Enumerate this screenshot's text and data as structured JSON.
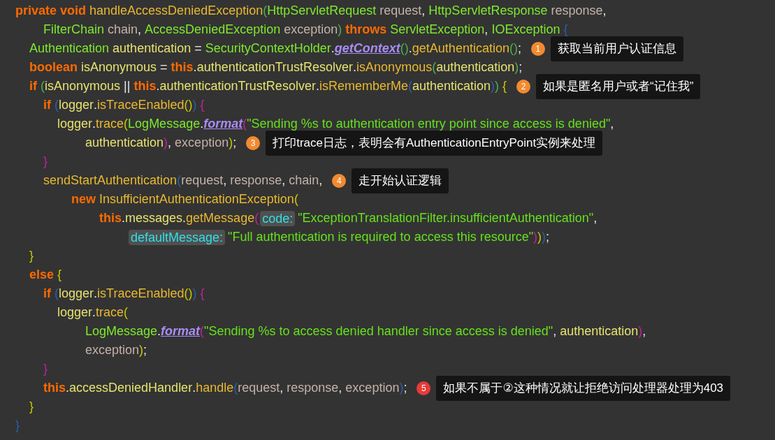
{
  "editor": {
    "lines": [
      {
        "kind": "statement",
        "tokens": [
          {
            "text": "private",
            "kind": "kw"
          },
          {
            "text": " void",
            "kind": "kw"
          },
          {
            "text": " handleAccessDeniedException",
            "kind": "fn"
          },
          {
            "text": "(",
            "kind": "bracket",
            "color": "#4caf50"
          },
          {
            "text": "HttpServletRequest",
            "kind": "type"
          },
          {
            "text": " request",
            "kind": "param"
          },
          {
            "text": ", ",
            "kind": "punct"
          },
          {
            "text": "HttpServletResponse",
            "kind": "type"
          },
          {
            "text": " response",
            "kind": "param"
          },
          {
            "text": ",",
            "kind": "punct"
          }
        ],
        "children": [
          {
            "kind": "continuation",
            "tokens": [
              {
                "text": "FilterChain",
                "kind": "type"
              },
              {
                "text": " chain",
                "kind": "param"
              },
              {
                "text": ", ",
                "kind": "punct"
              },
              {
                "text": "AccessDeniedException",
                "kind": "type"
              },
              {
                "text": " exception",
                "kind": "param"
              },
              {
                "text": ")",
                "kind": "bracket",
                "color": "#4caf50"
              },
              {
                "text": " throws",
                "kind": "kw"
              },
              {
                "text": " ServletException",
                "kind": "type"
              },
              {
                "text": ", ",
                "kind": "punct"
              },
              {
                "text": "IOException",
                "kind": "type"
              },
              {
                "text": " {",
                "kind": "bracket",
                "color": "#2a5fa8"
              }
            ]
          },
          {
            "kind": "statement",
            "tokens": [
              {
                "text": "Authentication",
                "kind": "type"
              },
              {
                "text": " authentication",
                "kind": "var"
              },
              {
                "text": " = ",
                "kind": "punct"
              },
              {
                "text": "SecurityContextHolder",
                "kind": "type"
              },
              {
                "text": ".",
                "kind": "punct"
              },
              {
                "text": "getContext",
                "kind": "static"
              },
              {
                "text": "()",
                "kind": "bracket",
                "color": "#4caf50"
              },
              {
                "text": ".",
                "kind": "punct"
              },
              {
                "text": "getAuthentication",
                "kind": "fn"
              },
              {
                "text": "()",
                "kind": "bracket",
                "color": "#4caf50"
              },
              {
                "text": ";",
                "kind": "punct"
              }
            ],
            "note": {
              "number": "1",
              "color": "#f28a30",
              "text": "获取当前用户认证信息"
            }
          },
          {
            "kind": "statement",
            "tokens": [
              {
                "text": "boolean",
                "kind": "kw"
              },
              {
                "text": " isAnonymous",
                "kind": "var"
              },
              {
                "text": " = ",
                "kind": "punct"
              },
              {
                "text": "this",
                "kind": "kw"
              },
              {
                "text": ".",
                "kind": "punct"
              },
              {
                "text": "authenticationTrustResolver",
                "kind": "var"
              },
              {
                "text": ".",
                "kind": "punct"
              },
              {
                "text": "isAnonymous",
                "kind": "fn"
              },
              {
                "text": "(",
                "kind": "bracket",
                "color": "#4caf50"
              },
              {
                "text": "authentication",
                "kind": "var"
              },
              {
                "text": ")",
                "kind": "bracket",
                "color": "#4caf50"
              },
              {
                "text": ";",
                "kind": "punct"
              }
            ]
          },
          {
            "kind": "statement",
            "tokens": [
              {
                "text": "if",
                "kind": "kw"
              },
              {
                "text": " (",
                "kind": "bracket",
                "color": "#4caf50"
              },
              {
                "text": "isAnonymous",
                "kind": "var"
              },
              {
                "text": " || ",
                "kind": "punct"
              },
              {
                "text": "this",
                "kind": "kw"
              },
              {
                "text": ".",
                "kind": "punct"
              },
              {
                "text": "authenticationTrustResolver",
                "kind": "var"
              },
              {
                "text": ".",
                "kind": "punct"
              },
              {
                "text": "isRememberMe",
                "kind": "fn"
              },
              {
                "text": "(",
                "kind": "bracket",
                "color": "#2a5fa8"
              },
              {
                "text": "authentication",
                "kind": "var"
              },
              {
                "text": ")",
                "kind": "bracket",
                "color": "#2a5fa8"
              },
              {
                "text": ")",
                "kind": "bracket",
                "color": "#4caf50"
              },
              {
                "text": " {",
                "kind": "bracket",
                "color": "#c8c800"
              }
            ],
            "note": {
              "number": "2",
              "color": "#f28a30",
              "text": "如果是匿名用户或者“记住我”"
            },
            "children": [
              {
                "kind": "statement",
                "tokens": [
                  {
                    "text": "if",
                    "kind": "kw"
                  },
                  {
                    "text": " (",
                    "kind": "bracket",
                    "color": "#2a5fa8"
                  },
                  {
                    "text": "logger",
                    "kind": "var"
                  },
                  {
                    "text": ".",
                    "kind": "punct"
                  },
                  {
                    "text": "isTraceEnabled",
                    "kind": "fn"
                  },
                  {
                    "text": "()",
                    "kind": "bracket",
                    "color": "#c8c800"
                  },
                  {
                    "text": ")",
                    "kind": "bracket",
                    "color": "#2a5fa8"
                  },
                  {
                    "text": " {",
                    "kind": "bracket",
                    "color": "#c020a0"
                  }
                ],
                "children": [
                  {
                    "kind": "statement",
                    "tokens": [
                      {
                        "text": "logger",
                        "kind": "var"
                      },
                      {
                        "text": ".",
                        "kind": "punct"
                      },
                      {
                        "text": "trace",
                        "kind": "fn"
                      },
                      {
                        "text": "(",
                        "kind": "bracket",
                        "color": "#c8c800"
                      },
                      {
                        "text": "LogMessage",
                        "kind": "type"
                      },
                      {
                        "text": ".",
                        "kind": "punct"
                      },
                      {
                        "text": "format",
                        "kind": "static"
                      },
                      {
                        "text": "(",
                        "kind": "bracket",
                        "color": "#c020a0"
                      },
                      {
                        "text": "\"Sending %s to authentication entry point since access is denied\"",
                        "kind": "str"
                      },
                      {
                        "text": ",",
                        "kind": "punct"
                      }
                    ],
                    "children": [
                      {
                        "kind": "continuation",
                        "tokens": [
                          {
                            "text": "authentication",
                            "kind": "var"
                          },
                          {
                            "text": ")",
                            "kind": "bracket",
                            "color": "#c020a0"
                          },
                          {
                            "text": ", ",
                            "kind": "punct"
                          },
                          {
                            "text": "exception",
                            "kind": "param"
                          },
                          {
                            "text": ")",
                            "kind": "bracket",
                            "color": "#c8c800"
                          },
                          {
                            "text": ";",
                            "kind": "punct"
                          }
                        ],
                        "note": {
                          "number": "3",
                          "color": "#f28a30",
                          "text": "打印trace日志，表明会有AuthenticationEntryPoint实例来处理"
                        }
                      }
                    ]
                  }
                ]
              },
              {
                "kind": "statement",
                "tokens": [
                  {
                    "text": "}",
                    "kind": "bracket",
                    "color": "#c020a0"
                  }
                ]
              },
              {
                "kind": "statement",
                "tokens": [
                  {
                    "text": "sendStartAuthentication",
                    "kind": "fn"
                  },
                  {
                    "text": "(",
                    "kind": "bracket",
                    "color": "#2a5fa8"
                  },
                  {
                    "text": "request",
                    "kind": "param"
                  },
                  {
                    "text": ", ",
                    "kind": "punct"
                  },
                  {
                    "text": "response",
                    "kind": "param"
                  },
                  {
                    "text": ", ",
                    "kind": "punct"
                  },
                  {
                    "text": "chain",
                    "kind": "param"
                  },
                  {
                    "text": ",",
                    "kind": "punct"
                  }
                ],
                "note": {
                  "number": "4",
                  "color": "#f28a30",
                  "text": "走开始认证逻辑"
                },
                "children": [
                  {
                    "kind": "continuation",
                    "tokens": [
                      {
                        "text": "new",
                        "kind": "kw"
                      },
                      {
                        "text": " InsufficientAuthenticationException",
                        "kind": "fn"
                      },
                      {
                        "text": "(",
                        "kind": "bracket",
                        "color": "#c8c800"
                      }
                    ],
                    "children": [
                      {
                        "kind": "continuation",
                        "tokens": [
                          {
                            "text": "this",
                            "kind": "kw"
                          },
                          {
                            "text": ".",
                            "kind": "punct"
                          },
                          {
                            "text": "messages",
                            "kind": "var"
                          },
                          {
                            "text": ".",
                            "kind": "punct"
                          },
                          {
                            "text": "getMessage",
                            "kind": "fn"
                          },
                          {
                            "text": "(",
                            "kind": "bracket",
                            "color": "#c020a0"
                          },
                          {
                            "text": "code:",
                            "kind": "hint"
                          },
                          {
                            "text": "\"ExceptionTranslationFilter.insufficientAuthentication\"",
                            "kind": "str"
                          },
                          {
                            "text": ",",
                            "kind": "punct"
                          }
                        ],
                        "children": [
                          {
                            "kind": "continuation",
                            "tokens": [
                              {
                                "text": "defaultMessage:",
                                "kind": "hint"
                              },
                              {
                                "text": "\"Full authentication is required to access this resource\"",
                                "kind": "str"
                              },
                              {
                                "text": ")",
                                "kind": "bracket",
                                "color": "#c020a0"
                              },
                              {
                                "text": ")",
                                "kind": "bracket",
                                "color": "#c8c800"
                              },
                              {
                                "text": ")",
                                "kind": "bracket",
                                "color": "#2a5fa8"
                              },
                              {
                                "text": ";",
                                "kind": "punct"
                              }
                            ]
                          }
                        ]
                      }
                    ]
                  }
                ]
              }
            ]
          },
          {
            "kind": "statement",
            "tokens": [
              {
                "text": "}",
                "kind": "bracket",
                "color": "#c8c800"
              }
            ]
          },
          {
            "kind": "statement",
            "tokens": [
              {
                "text": "else",
                "kind": "kw"
              },
              {
                "text": " {",
                "kind": "bracket",
                "color": "#c8c800"
              }
            ],
            "children": [
              {
                "kind": "statement",
                "tokens": [
                  {
                    "text": "if",
                    "kind": "kw"
                  },
                  {
                    "text": " (",
                    "kind": "bracket",
                    "color": "#2a5fa8"
                  },
                  {
                    "text": "logger",
                    "kind": "var"
                  },
                  {
                    "text": ".",
                    "kind": "punct"
                  },
                  {
                    "text": "isTraceEnabled",
                    "kind": "fn"
                  },
                  {
                    "text": "()",
                    "kind": "bracket",
                    "color": "#c8c800"
                  },
                  {
                    "text": ")",
                    "kind": "bracket",
                    "color": "#2a5fa8"
                  },
                  {
                    "text": " {",
                    "kind": "bracket",
                    "color": "#c020a0"
                  }
                ],
                "children": [
                  {
                    "kind": "statement",
                    "tokens": [
                      {
                        "text": "logger",
                        "kind": "var"
                      },
                      {
                        "text": ".",
                        "kind": "punct"
                      },
                      {
                        "text": "trace",
                        "kind": "fn"
                      },
                      {
                        "text": "(",
                        "kind": "bracket",
                        "color": "#c8c800"
                      }
                    ],
                    "children": [
                      {
                        "kind": "continuation",
                        "tokens": [
                          {
                            "text": "LogMessage",
                            "kind": "type"
                          },
                          {
                            "text": ".",
                            "kind": "punct"
                          },
                          {
                            "text": "format",
                            "kind": "static"
                          },
                          {
                            "text": "(",
                            "kind": "bracket",
                            "color": "#c020a0"
                          },
                          {
                            "text": "\"Sending %s to access denied handler since access is denied\"",
                            "kind": "str"
                          },
                          {
                            "text": ", ",
                            "kind": "punct"
                          },
                          {
                            "text": "authentication",
                            "kind": "var"
                          },
                          {
                            "text": ")",
                            "kind": "bracket",
                            "color": "#c020a0"
                          },
                          {
                            "text": ",",
                            "kind": "punct"
                          }
                        ]
                      },
                      {
                        "kind": "continuation",
                        "tokens": [
                          {
                            "text": "exception",
                            "kind": "param"
                          },
                          {
                            "text": ")",
                            "kind": "bracket",
                            "color": "#c8c800"
                          },
                          {
                            "text": ";",
                            "kind": "punct"
                          }
                        ]
                      }
                    ]
                  }
                ]
              },
              {
                "kind": "statement",
                "tokens": [
                  {
                    "text": "}",
                    "kind": "bracket",
                    "color": "#c020a0"
                  }
                ]
              },
              {
                "kind": "statement",
                "tokens": [
                  {
                    "text": "this",
                    "kind": "kw"
                  },
                  {
                    "text": ".",
                    "kind": "punct"
                  },
                  {
                    "text": "accessDeniedHandler",
                    "kind": "var"
                  },
                  {
                    "text": ".",
                    "kind": "punct"
                  },
                  {
                    "text": "handle",
                    "kind": "fn"
                  },
                  {
                    "text": "(",
                    "kind": "bracket",
                    "color": "#2a5fa8"
                  },
                  {
                    "text": "request",
                    "kind": "param"
                  },
                  {
                    "text": ", ",
                    "kind": "punct"
                  },
                  {
                    "text": "response",
                    "kind": "param"
                  },
                  {
                    "text": ", ",
                    "kind": "punct"
                  },
                  {
                    "text": "exception",
                    "kind": "param"
                  },
                  {
                    "text": ")",
                    "kind": "bracket",
                    "color": "#2a5fa8"
                  },
                  {
                    "text": ";",
                    "kind": "punct"
                  }
                ],
                "note": {
                  "number": "5",
                  "color": "#e83a3a",
                  "text": "如果不属于②这种情况就让拒绝访问处理器处理为403"
                }
              }
            ]
          },
          {
            "kind": "statement",
            "tokens": [
              {
                "text": "}",
                "kind": "bracket",
                "color": "#c8c800"
              }
            ]
          }
        ]
      },
      {
        "kind": "statement",
        "tokens": [
          {
            "text": "}",
            "kind": "bracket",
            "color": "#2a5fa8"
          }
        ]
      }
    ]
  }
}
